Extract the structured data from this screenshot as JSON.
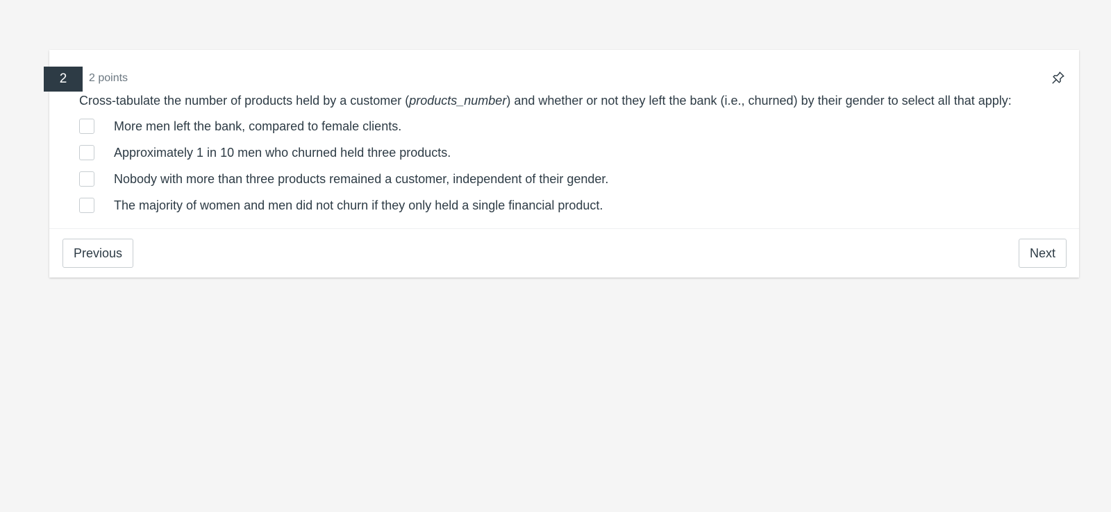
{
  "question": {
    "number": "2",
    "points": "2 points",
    "text_before": "Cross-tabulate the number of products held by a customer (",
    "text_italic": "products_number",
    "text_after": ") and whether or not they left the bank (i.e., churned) by their gender to select all that apply:",
    "options": [
      {
        "label": "More men left the bank, compared to female clients.",
        "checked": false
      },
      {
        "label": "Approximately 1 in 10 men who churned held three products.",
        "checked": false
      },
      {
        "label": "Nobody with more than three products remained a customer, independent of their gender.",
        "checked": false
      },
      {
        "label": "The majority of women and men did not churn if they only held a single financial product.",
        "checked": false
      }
    ]
  },
  "navigation": {
    "previous_label": "Previous",
    "next_label": "Next"
  },
  "icons": {
    "pin": "pin-icon"
  },
  "colors": {
    "badge_background": "#2d3b45",
    "text": "#2d3b45",
    "muted_text": "#6b7780",
    "page_background": "#f5f5f5"
  }
}
